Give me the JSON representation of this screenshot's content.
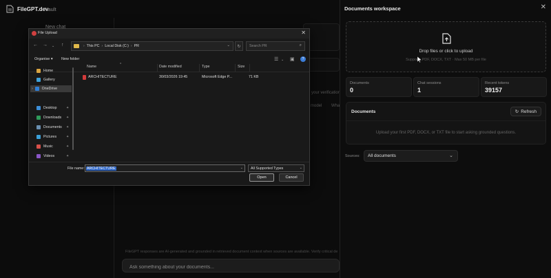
{
  "app": {
    "title": "FileGPT.dev",
    "nav_vault": "Vault",
    "new_chat": "New chat",
    "disclaimer": "FileGPT responses are AI-generated and grounded in retrieved document context when sources are available. Verify critical decisions against",
    "chat_placeholder": "Ask something about your documents...",
    "ghost_verification": "your verification",
    "ghost_model": "model",
    "ghost_what": "What"
  },
  "panel": {
    "title": "Documents workspace",
    "close": "✕",
    "dropzone": {
      "main": "Drop files or click to upload",
      "sub": "Supports PDF, DOCX, TXT · Max 50 MB per file"
    },
    "stats": [
      {
        "label": "Documents",
        "value": "0"
      },
      {
        "label": "Chat sessions",
        "value": "1"
      },
      {
        "label": "Recent tokens",
        "value": "39157"
      }
    ],
    "docs": {
      "title": "Documents",
      "refresh": "Refresh",
      "empty": "Upload your first PDF, DOCX, or TXT file to start asking grounded questions."
    },
    "sources": {
      "label": "Sources:",
      "value": "All documents"
    }
  },
  "dialog": {
    "title": "File Upload",
    "close": "✕",
    "breadcrumb": [
      "This PC",
      "Local Disk (C:)",
      "PR"
    ],
    "search_placeholder": "Search PR",
    "organise": "Organise ▾",
    "new_folder": "New folder",
    "nav_items": [
      {
        "label": "Home",
        "color": "#d9a441"
      },
      {
        "label": "Gallery",
        "color": "#3fa1d8"
      },
      {
        "label": "OneDrive",
        "color": "#2f7fd6"
      },
      {
        "label": "Desktop",
        "color": "#3d8fd9"
      },
      {
        "label": "Downloads",
        "color": "#2f9b5a"
      },
      {
        "label": "Documents",
        "color": "#6a8fb0"
      },
      {
        "label": "Pictures",
        "color": "#3ba0d8"
      },
      {
        "label": "Music",
        "color": "#d8504a"
      },
      {
        "label": "Videos",
        "color": "#8a56c7"
      }
    ],
    "columns": {
      "name": "Name",
      "date": "Date modified",
      "type": "Type",
      "size": "Size"
    },
    "files": [
      {
        "name": "ARCHITECTURE",
        "date": "30/03/2026 19:45",
        "type": "Microsoft Edge P...",
        "size": "71 KB"
      }
    ],
    "file_name_label": "File name:",
    "file_name_value": "ARCHITECTURE",
    "file_type": "All Supported Types",
    "open": "Open",
    "cancel": "Cancel"
  }
}
